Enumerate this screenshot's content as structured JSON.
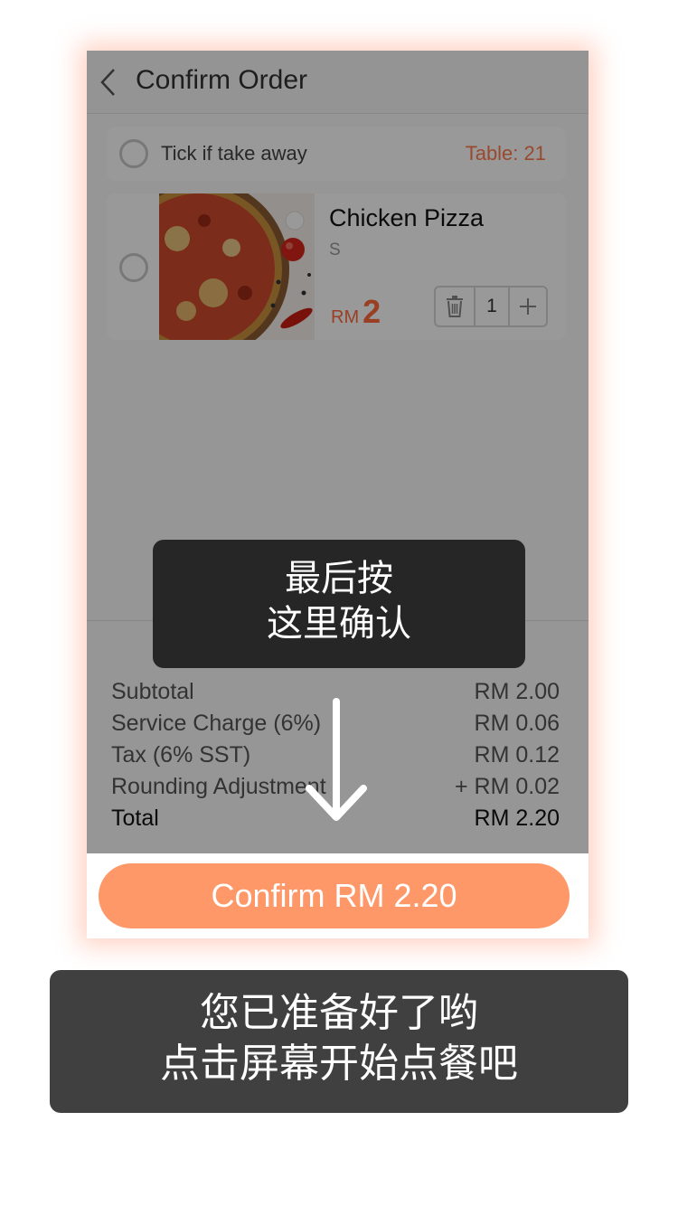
{
  "nav": {
    "title": "Confirm Order",
    "back_icon": "chevron-left-icon"
  },
  "takeaway": {
    "label": "Tick if take away",
    "table": "Table: 21"
  },
  "item": {
    "name": "Chicken Pizza",
    "variant": "S",
    "currency": "RM",
    "price": "2",
    "quantity": "1",
    "delete_icon": "trash-icon",
    "add_icon": "plus-icon"
  },
  "summary": {
    "rows": [
      {
        "label": "Subtotal",
        "value": "RM 2.00"
      },
      {
        "label": "Service Charge (6%)",
        "value": "RM 0.06"
      },
      {
        "label": "Tax (6% SST)",
        "value": "RM 0.12"
      },
      {
        "label": "Rounding Adjustment",
        "value": "+ RM 0.02"
      }
    ],
    "total": {
      "label": "Total",
      "value": "RM 2.20"
    }
  },
  "confirm": {
    "label": "Confirm RM 2.20"
  },
  "tooltip_top": {
    "line1": "最后按",
    "line2": "这里确认"
  },
  "tooltip_bottom": {
    "line1": "您已准备好了哟",
    "line2": "点击屏幕开始点餐吧"
  },
  "colors": {
    "accent": "#ff9868",
    "price": "#ff6a3d",
    "overlay": "#262626"
  }
}
